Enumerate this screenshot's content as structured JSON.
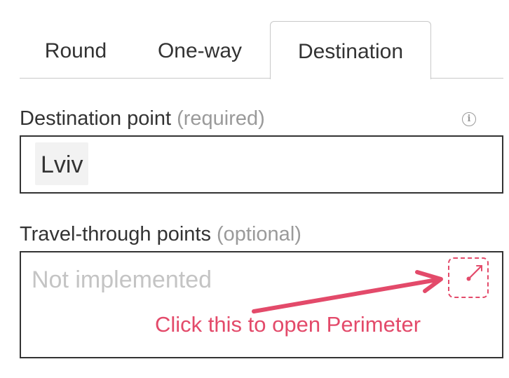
{
  "tabs": [
    {
      "label": "Round",
      "active": false
    },
    {
      "label": "One-way",
      "active": false
    },
    {
      "label": "Destination",
      "active": true
    }
  ],
  "destination": {
    "label": "Destination point",
    "hint": "(required)",
    "info_icon": "info-circle-icon",
    "value": "Lviv"
  },
  "travel_through": {
    "label": "Travel-through points",
    "hint": "(optional)",
    "placeholder": "Not implemented",
    "button_icon": "perimeter-radius-icon"
  },
  "annotation": {
    "text": "Click this to open Perimeter",
    "color": "#e34a6a"
  },
  "colors": {
    "accent": "#e34a6a",
    "border": "#333333",
    "muted": "#9a9a9a"
  }
}
